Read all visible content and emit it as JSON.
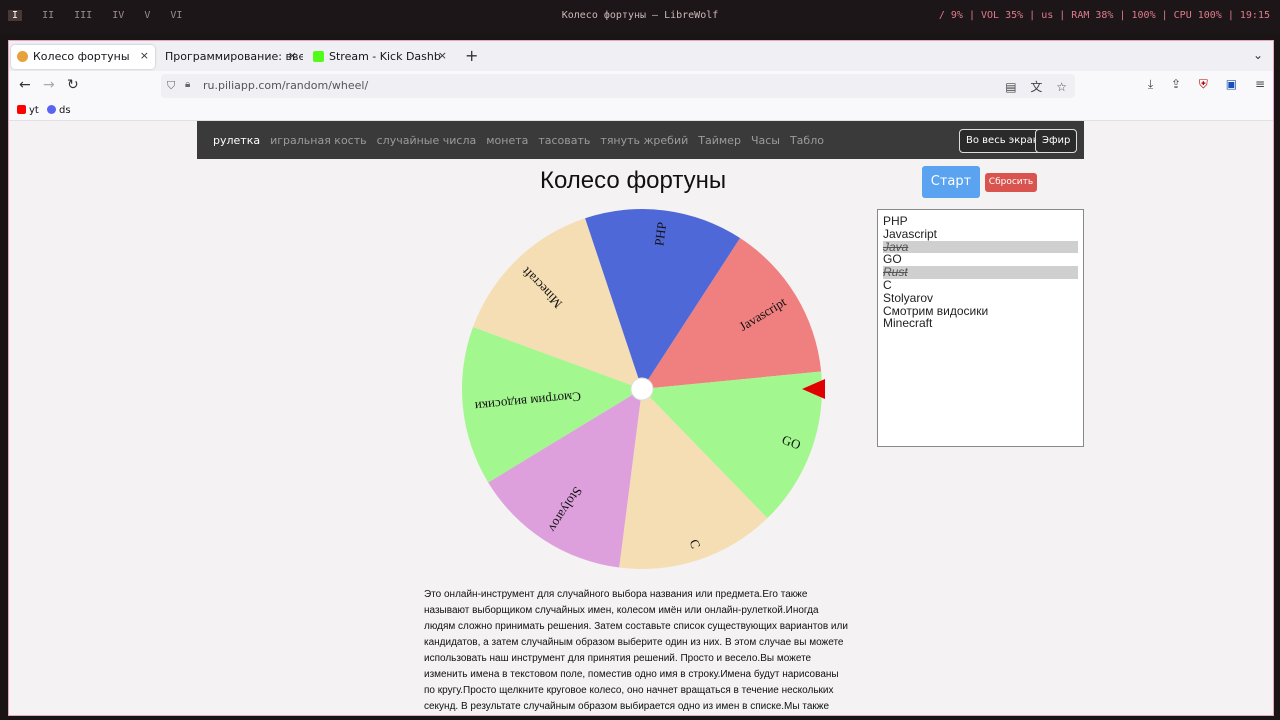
{
  "system_bar": {
    "workspaces": [
      "I",
      "II",
      "III",
      "IV",
      "V",
      "VI"
    ],
    "window_title": "Колесо фортуны — LibreWolf",
    "stats": "/ 9% | VOL 35% | us | RAM 38% | 100% | CPU 100% | 19:15"
  },
  "browser": {
    "tabs": [
      {
        "label": "Колесо фортуны",
        "color": "#e6a23c"
      },
      {
        "label": "Программирование: введ",
        "color": ""
      },
      {
        "label": "Stream - Kick Dashb",
        "color": "#53fc18"
      }
    ],
    "close_glyph": "×",
    "new_tab_glyph": "+",
    "url": "ru.piliapp.com/random/wheel/",
    "bookmarks": [
      {
        "label": "yt",
        "color": "#ff0000"
      },
      {
        "label": "ds",
        "color": "#5865f2"
      }
    ]
  },
  "site": {
    "nav_items": [
      "рулетка",
      "игральная кость",
      "случайные числа",
      "монета",
      "тасовать",
      "тянуть жребий",
      "Таймер",
      "Часы",
      "Табло"
    ],
    "fullscreen_label": "Во весь экран",
    "broadcast_label": "Эфир",
    "title": "Колесо фортуны",
    "start_label": "Старт",
    "reset_label": "Сбросить"
  },
  "wheel": {
    "segments": [
      {
        "label": "Javascript",
        "color": "#f08080"
      },
      {
        "label": "GO",
        "color": "#a3f78f"
      },
      {
        "label": "C",
        "color": "#f5deb3"
      },
      {
        "label": "Stolyarov",
        "color": "#dda0dd"
      },
      {
        "label": "Смотрим видосики",
        "color": "#a3f78f"
      },
      {
        "label": "Minecraft",
        "color": "#f5deb3"
      },
      {
        "label": "PHP",
        "color": "#4f68d8"
      }
    ],
    "pointer_color": "#e00000"
  },
  "list": [
    {
      "text": "PHP",
      "struck": false
    },
    {
      "text": "Javascript",
      "struck": false
    },
    {
      "text": "Java",
      "struck": true
    },
    {
      "text": "GO",
      "struck": false
    },
    {
      "text": "Rust",
      "struck": true
    },
    {
      "text": "C",
      "struck": false
    },
    {
      "text": "Stolyarov",
      "struck": false
    },
    {
      "text": "Смотрим видосики",
      "struck": false
    },
    {
      "text": "Minecraft",
      "struck": false
    }
  ],
  "description": [
    "Это онлайн-инструмент для случайного выбора названия или предмета.Его также",
    "называют выборщиком случайных имен, колесом имён или онлайн-рулеткой.Иногда",
    "людям сложно принимать решения. Затем составьте список существующих вариантов или",
    "кандидатов, а затем случайным образом выберите один из них. В этом случае вы можете",
    "использовать наш инструмент для принятия решений. Просто и весело.Вы можете",
    "изменить имена в текстовом поле, поместив одно имя в строку.Имена будут нарисованы",
    "по кругу.Просто щелкните круговое колесо, оно начнет вращаться в течение нескольких",
    "секунд. В результате случайным образом выбирается одно из имен в списке.Мы также"
  ]
}
